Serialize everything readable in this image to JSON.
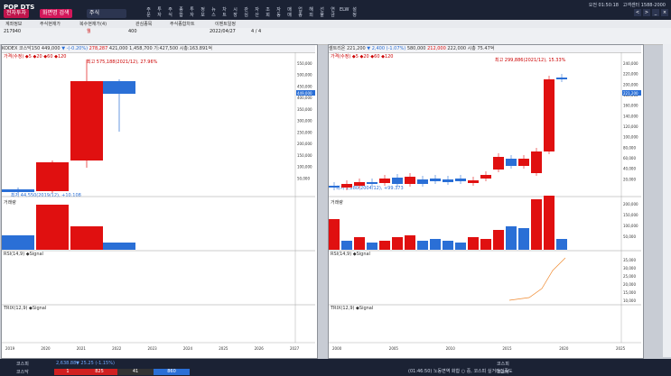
{
  "app": {
    "logo": "POP DTS",
    "tab_pill": "전자투자",
    "order_pill": "화면명 검색",
    "account_pill": "주식",
    "clock": "오전 01:50:18",
    "center_phone": "고객센터 1588-2000"
  },
  "menu": [
    "주문",
    "투자",
    "주식",
    "종합",
    "투자",
    "정보",
    "뉴스",
    "차트",
    "시장",
    "관심",
    "자산",
    "조회",
    "자동",
    "매매",
    "업종",
    "해외",
    "선물",
    "연금",
    "ELW",
    "설정"
  ],
  "tabs": [
    "계좌정보",
    "주식현재가",
    "복수현재가(4)",
    "관심종목",
    "주식종합차트",
    "이벤트일정"
  ],
  "toolbar": {
    "code": "217940",
    "period_unit": "월",
    "count": "400",
    "date": "2022/04/27",
    "ratio": "4 / 4"
  },
  "left_panel": {
    "title": "KODEX 코스닥150",
    "price": "449,000",
    "change": "▼ -(-0.20%)",
    "high": "278,287",
    "low": "421,000",
    "vol": "1,458,700",
    "info": "기:427,500 시총:163.891억",
    "legend": "가격(수정) ◆5 ◆20 ◆60 ◆120",
    "max_label": "최고 575,188(2021/12), 27.96%",
    "min_label": "최저 44,550(2019/12), +10.108",
    "vol_legend": "거래량",
    "ind1_legend": "RSI(14,9) ◆Signal",
    "ind2_legend": "TRIX(12,9) ◆Signal",
    "y_ticks": [
      "550,000",
      "500,000",
      "450,000",
      "400,000",
      "350,000",
      "300,000",
      "250,000",
      "200,000",
      "150,000",
      "100,000",
      "50,000"
    ],
    "price_tag": "449,000",
    "x_ticks": [
      "2019",
      "2020",
      "2021",
      "2022",
      "2023",
      "2024",
      "2025",
      "2026",
      "2027"
    ]
  },
  "right_panel": {
    "title": "셀트리온",
    "price": "221,200",
    "change": "▼ 2,400 (-1.07%)",
    "open": "580,000",
    "high": "212,000",
    "low": "222,000",
    "close": "200,800",
    "info": "시총 75.47억",
    "legend": "가격(수정) ◆5 ◆20 ◆60 ◆120",
    "max_label": "최고 299,886(2021/12), 15.33%",
    "min_label": "최저 1,280(2004/12), +99.373",
    "vol_legend": "거래량",
    "ind1_legend": "RSI(14,9) ◆Signal",
    "ind2_legend": "TRIX(12,9) ◆Signal",
    "y_ticks": [
      "240,000",
      "220,000",
      "200,000",
      "180,000",
      "160,000",
      "140,000",
      "120,000",
      "100,000",
      "80,000",
      "60,000",
      "40,000",
      "20,000"
    ],
    "vol_ticks": [
      "200,000",
      "150,000",
      "100,000",
      "50,000"
    ],
    "ind_ticks": [
      "35,000",
      "30,000",
      "25,000",
      "20,000",
      "15,000",
      "10,000"
    ],
    "price_tag": "221,200",
    "x_ticks": [
      "2000",
      "2005",
      "2010",
      "2015",
      "2020",
      "2025"
    ]
  },
  "status": {
    "kospi_label": "코스피",
    "kospi_val": "2,638.88",
    "kospi_chg": "▼ 25.25 (-1.15%)",
    "kosdaq_label": "코스닥",
    "kosdaq_vals": [
      "1",
      "825",
      "41",
      "860"
    ],
    "news": "(01:46:50) 노동면역 화합 ○ 중, 코스피 실거래집중도",
    "right_a": "코스피",
    "right_b": "코스닥"
  },
  "colors": {
    "up": "#e01010",
    "down": "#2a6fd6",
    "dark": "#1b2234"
  }
}
